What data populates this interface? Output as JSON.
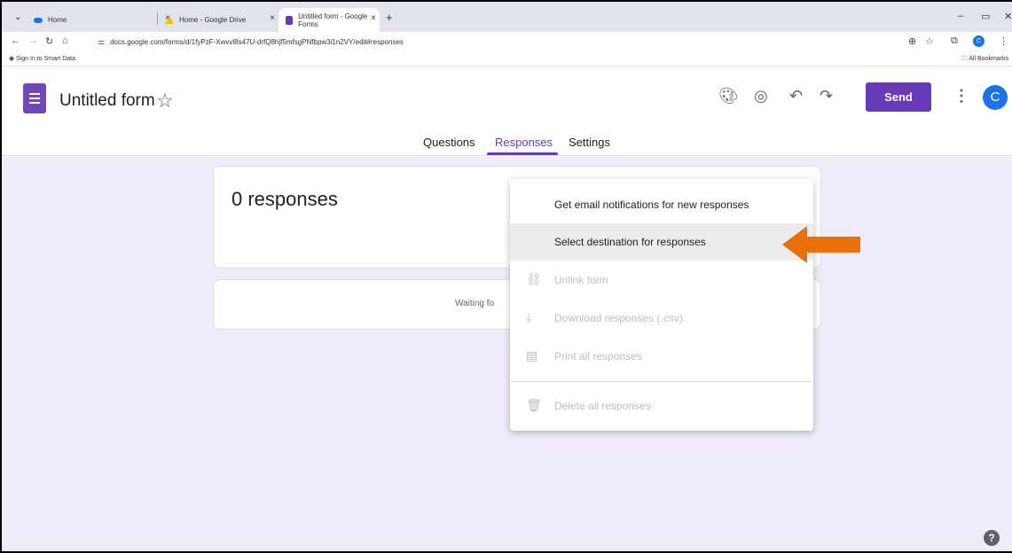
{
  "browser": {
    "tabs": [
      {
        "title": "Home",
        "close": "×"
      },
      {
        "title": "Home - Google Drive",
        "close": "×"
      },
      {
        "title": "Untitled form - Google Forms",
        "close": "×"
      }
    ],
    "new_tab": "+",
    "url": "docs.google.com/forms/d/1fyPzF-Xwvvl8s47U-drfQ8hjf5mfsgPNfbpw3i1n2VY/edit#responses",
    "profile_initial": "C",
    "bookmarks": {
      "left": "Sign In to Smart Data",
      "right": "All Bookmarks"
    }
  },
  "header": {
    "form_title": "Untitled form",
    "send_label": "Send",
    "avatar_initial": "C"
  },
  "nav": {
    "tabs": [
      {
        "label": "Questions"
      },
      {
        "label": "Responses"
      },
      {
        "label": "Settings"
      }
    ],
    "active": "Responses"
  },
  "main": {
    "responses_count": "0 responses",
    "waiting_text": "Waiting fo"
  },
  "menu": {
    "items": [
      {
        "label": "Get email notifications for new responses",
        "enabled": true
      },
      {
        "label": "Select destination for responses",
        "enabled": true,
        "highlighted": true
      },
      {
        "label": "Unlink form",
        "enabled": false,
        "icon": "unlink-icon"
      },
      {
        "label": "Download responses (.csv)",
        "enabled": false,
        "icon": "download-icon"
      },
      {
        "label": "Print all responses",
        "enabled": false,
        "icon": "print-icon"
      },
      {
        "label": "Delete all responses",
        "enabled": false,
        "icon": "trash-icon"
      }
    ]
  },
  "colors": {
    "brand_purple": "#673ab7",
    "background_lavender": "#f0ebf8",
    "annotation_arrow": "#e8710a"
  }
}
